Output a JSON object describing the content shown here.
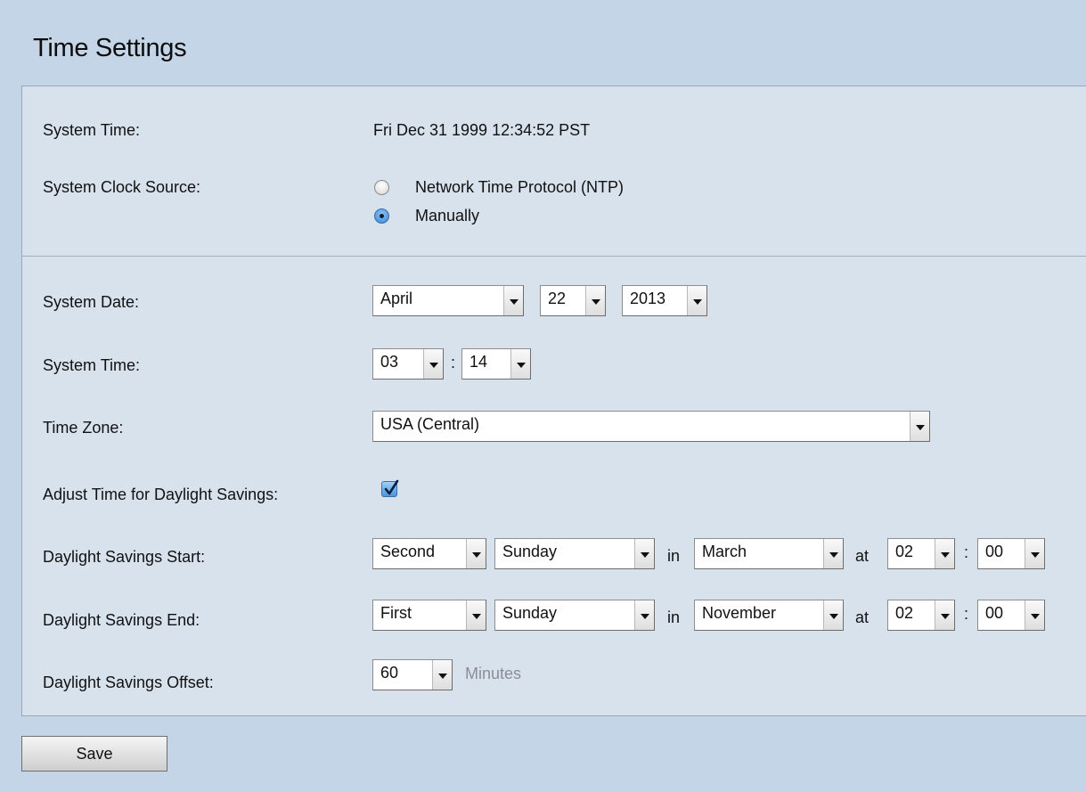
{
  "page_title": "Time Settings",
  "fields": {
    "system_time_label": "System Time:",
    "system_time_value": "Fri Dec 31 1999 12:34:52 PST",
    "clock_source_label": "System Clock Source:",
    "clock_source_options": [
      "Network Time Protocol (NTP)",
      "Manually"
    ],
    "clock_source_selected": "Manually",
    "system_date_label": "System Date:",
    "system_date": {
      "month": "April",
      "day": "22",
      "year": "2013"
    },
    "manual_time_label": "System Time:",
    "manual_time": {
      "hour": "03",
      "sep": ":",
      "minute": "14"
    },
    "time_zone_label": "Time Zone:",
    "time_zone": "USA (Central)",
    "dst_adjust_label": "Adjust Time for Daylight Savings:",
    "dst_adjust_checked": true,
    "dst_start_label": "Daylight Savings Start:",
    "dst_start": {
      "week": "Second",
      "weekday": "Sunday",
      "in": "in",
      "month": "March",
      "at": "at",
      "hour": "02",
      "sep": ":",
      "minute": "00"
    },
    "dst_end_label": "Daylight Savings End:",
    "dst_end": {
      "week": "First",
      "weekday": "Sunday",
      "in": "in",
      "month": "November",
      "at": "at",
      "hour": "02",
      "sep": ":",
      "minute": "00"
    },
    "dst_offset_label": "Daylight Savings Offset:",
    "dst_offset": "60",
    "dst_offset_unit": "Minutes"
  },
  "buttons": {
    "save": "Save"
  },
  "icons": {
    "dropdown": "chevron-down-icon",
    "checkbox": "checkmark-icon"
  }
}
